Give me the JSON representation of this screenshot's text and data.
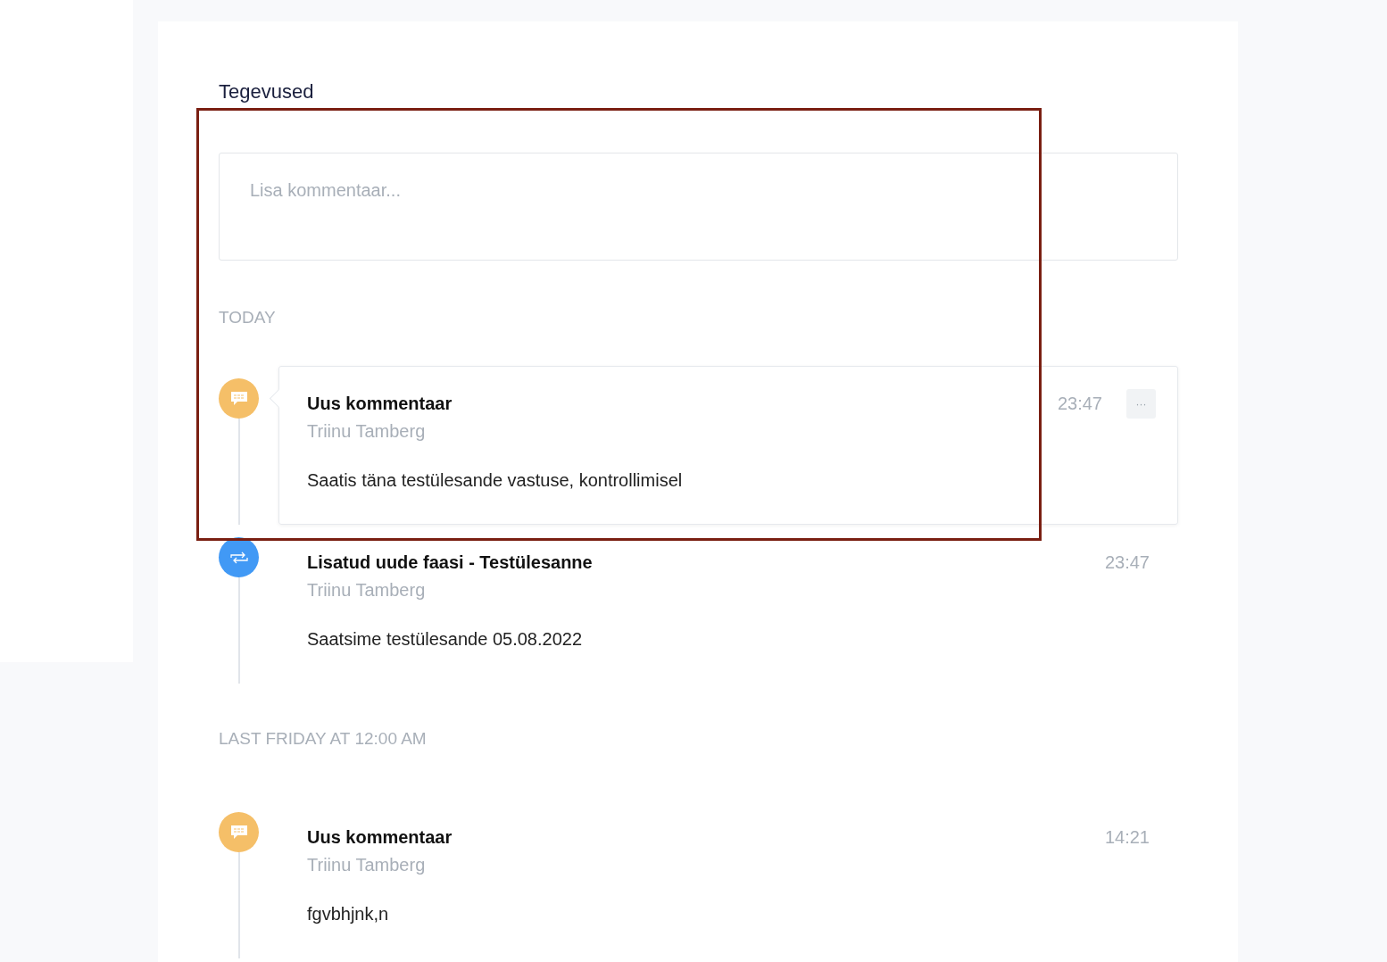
{
  "title": "Tegevused",
  "comment_field": {
    "placeholder": "Lisa kommentaar..."
  },
  "groups": [
    {
      "label": "TODAY",
      "entries": [
        {
          "kind": "comment",
          "title": "Uus kommentaar",
          "author": "Triinu Tamberg",
          "time": "23:47",
          "body": "Saatis täna testülesande vastuse, kontrollimisel",
          "hovered": true,
          "menu": "···"
        },
        {
          "kind": "phase",
          "title": "Lisatud uude faasi - Testülesanne",
          "author": "Triinu Tamberg",
          "time": "23:47",
          "body": "Saatsime testülesande 05.08.2022",
          "hovered": false
        }
      ]
    },
    {
      "label": "LAST FRIDAY AT 12:00 AM",
      "entries": [
        {
          "kind": "comment",
          "title": "Uus kommentaar",
          "author": "Triinu Tamberg",
          "time": "14:21",
          "body": "fgvbhjnk,n",
          "hovered": false
        }
      ]
    }
  ]
}
